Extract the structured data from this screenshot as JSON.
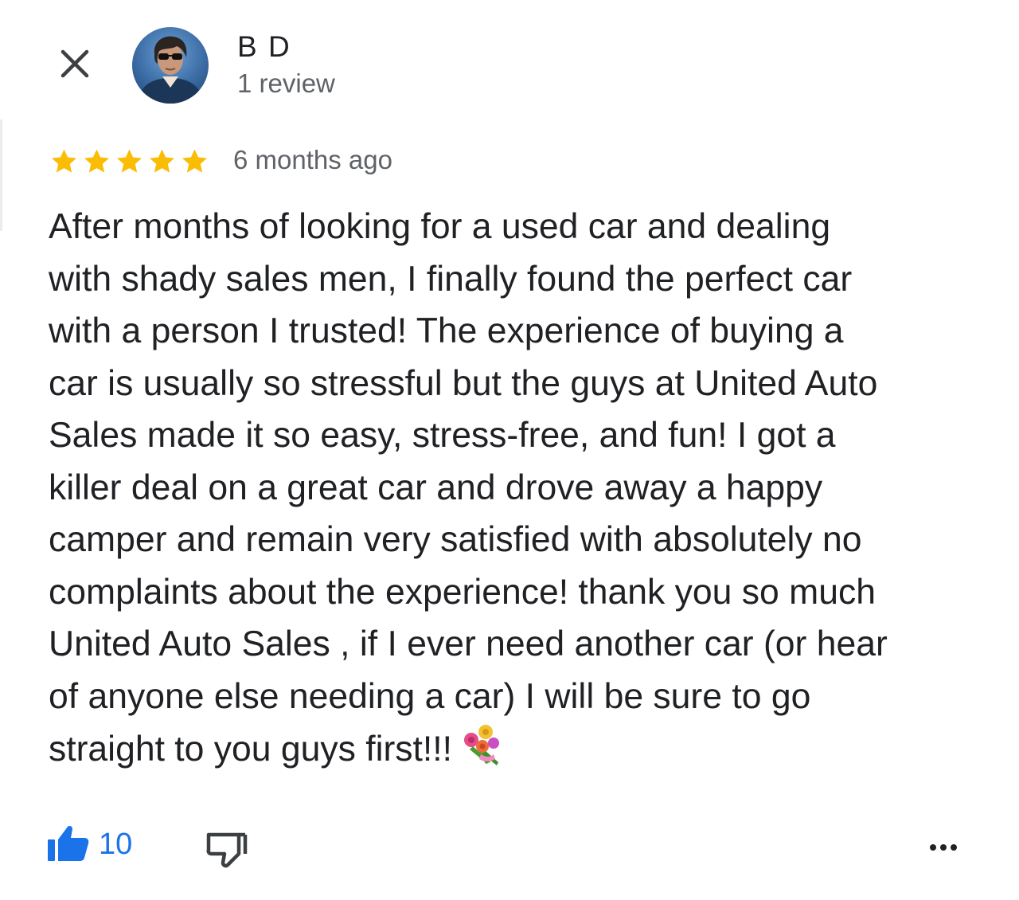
{
  "reviewer": {
    "name": "B D",
    "review_count": "1 review",
    "avatar_icon": "person-photo"
  },
  "review": {
    "rating": 5,
    "max_rating": 5,
    "timestamp": "6 months ago",
    "lines": [
      "After months of looking for a used car and dealing",
      "with shady sales men, I finally found the perfect car",
      "with a person I trusted! The experience of buying a",
      "car is usually so stressful but the guys at United Auto",
      "Sales made it so easy, stress-free, and fun! I got a",
      "killer deal on a great car and drove away a happy",
      "camper and remain very satisfied with absolutely no",
      "complaints about the experience! thank you so much",
      "United Auto Sales , if I ever need another car (or hear",
      "of anyone else needing a car) I will be sure to go",
      "straight to you guys first!!!"
    ],
    "trailing_emoji": "bouquet"
  },
  "actions": {
    "like_count": "10",
    "like_icon": "thumbs-up-filled-icon",
    "dislike_icon": "thumbs-down-outline-icon",
    "more_icon": "more-horizontal-icon",
    "close_icon": "close-icon"
  },
  "colors": {
    "star": "#fbbc04",
    "like_blue": "#1a73e8",
    "text_primary": "#202124",
    "text_secondary": "#5f6368"
  }
}
